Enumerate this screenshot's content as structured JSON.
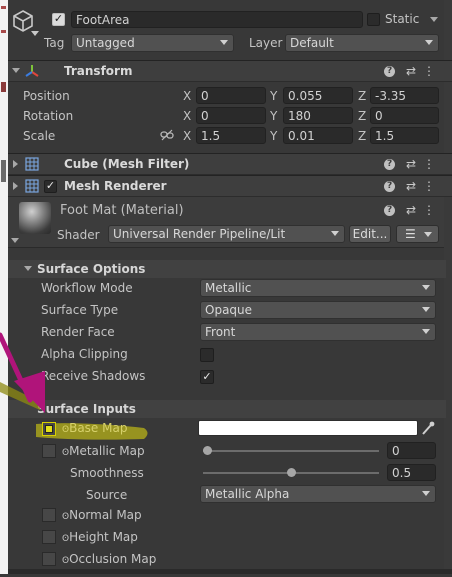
{
  "gameobject": {
    "name": "FootArea",
    "static_label": "Static",
    "tag_label": "Tag",
    "tag_value": "Untagged",
    "layer_label": "Layer",
    "layer_value": "Default",
    "icon": "cube-icon"
  },
  "transform": {
    "title": "Transform",
    "icon": "transform-axes-icon",
    "rows": [
      {
        "label": "Position",
        "x": "0",
        "y": "0.055",
        "z": "-3.35"
      },
      {
        "label": "Rotation",
        "x": "0",
        "y": "180",
        "z": "0"
      },
      {
        "label": "Scale",
        "x": "1.5",
        "y": "0.01",
        "z": "1.5"
      }
    ],
    "axis_x": "X",
    "axis_y": "Y",
    "axis_z": "Z",
    "scale_link_icon": "link-broken-icon"
  },
  "mesh_filter": {
    "title": "Cube (Mesh Filter)",
    "icon": "grid-icon"
  },
  "mesh_renderer": {
    "title": "Mesh Renderer",
    "icon": "grid-icon"
  },
  "material": {
    "title": "Foot Mat (Material)",
    "shader_label": "Shader",
    "shader_value": "Universal Render Pipeline/Lit",
    "edit_button": "Edit...",
    "list_icon": "list-icon"
  },
  "surface_options": {
    "title": "Surface Options",
    "rows": [
      {
        "label": "Workflow Mode",
        "value": "Metallic",
        "kind": "dropdown"
      },
      {
        "label": "Surface Type",
        "value": "Opaque",
        "kind": "dropdown"
      },
      {
        "label": "Render Face",
        "value": "Front",
        "kind": "dropdown"
      },
      {
        "label": "Alpha Clipping",
        "value": "",
        "kind": "checkbox"
      },
      {
        "label": "Receive Shadows",
        "value": "✓",
        "kind": "checkbox"
      }
    ]
  },
  "surface_inputs": {
    "title": "Surface Inputs",
    "base_map": "Base Map",
    "metallic_map": "Metallic Map",
    "metallic_value": "0",
    "metallic_level": 0.0,
    "smoothness": "Smoothness",
    "smoothness_value": "0.5",
    "smoothness_level": 0.5,
    "source": "Source",
    "source_value": "Metallic Alpha",
    "normal_map": "Normal Map",
    "height_map": "Height Map",
    "occlusion_map": "Occlusion Map",
    "base_color": "#ffffff",
    "eyedropper_icon": "eyedropper-icon"
  },
  "colors": {
    "highlight": "#e3e01a",
    "arrow": "#b0147a"
  }
}
